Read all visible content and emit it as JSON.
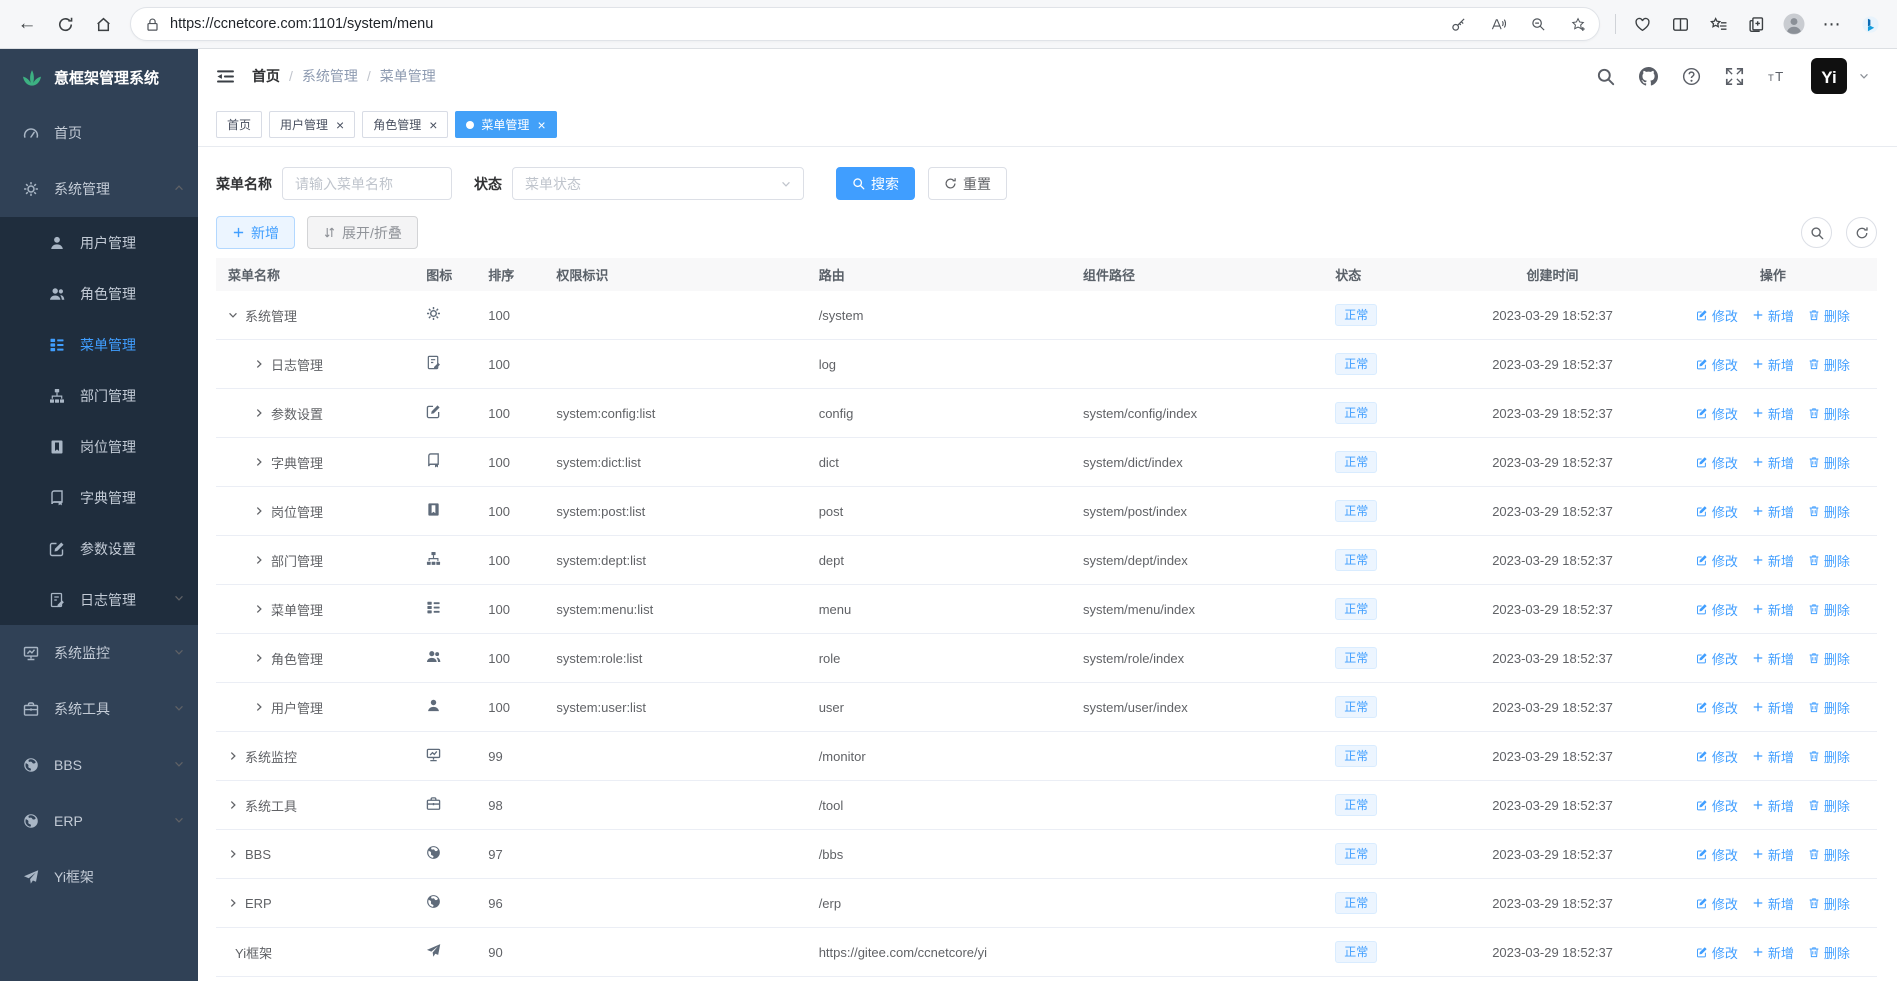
{
  "browser": {
    "url": "https://ccnetcore.com:1101/system/menu",
    "nav_icons": [
      "back-icon",
      "reload-icon",
      "home-icon"
    ],
    "pill_icons": [
      "lock-icon",
      "key-icon",
      "read-aloud-icon",
      "zoom-out-icon",
      "add-favorite-icon"
    ],
    "right_icons": [
      "browser-essentials-icon",
      "split-screen-icon",
      "favorites-icon",
      "collections-icon",
      "profile-avatar",
      "more-icon",
      "bing-chat-icon"
    ]
  },
  "sidebar": {
    "title": "意框架管理系统",
    "items": [
      {
        "label": "首页",
        "icon": "dashboard"
      },
      {
        "label": "系统管理",
        "icon": "gear",
        "expanded": true,
        "chevron": "up",
        "children": [
          {
            "label": "用户管理",
            "icon": "user"
          },
          {
            "label": "角色管理",
            "icon": "users"
          },
          {
            "label": "菜单管理",
            "icon": "tree-list",
            "active": true
          },
          {
            "label": "部门管理",
            "icon": "org"
          },
          {
            "label": "岗位管理",
            "icon": "badge"
          },
          {
            "label": "字典管理",
            "icon": "dict"
          },
          {
            "label": "参数设置",
            "icon": "edit-square"
          },
          {
            "label": "日志管理",
            "icon": "log",
            "chevron": "down"
          }
        ]
      },
      {
        "label": "系统监控",
        "icon": "monitor",
        "chevron": "down"
      },
      {
        "label": "系统工具",
        "icon": "toolbox",
        "chevron": "down"
      },
      {
        "label": "BBS",
        "icon": "globe",
        "chevron": "down"
      },
      {
        "label": "ERP",
        "icon": "globe",
        "chevron": "down"
      },
      {
        "label": "Yi框架",
        "icon": "send"
      }
    ]
  },
  "header": {
    "breadcrumb": [
      "首页",
      "系统管理",
      "菜单管理"
    ],
    "right_icons": [
      "search-icon",
      "github-icon",
      "question-icon",
      "fullscreen-icon",
      "font-size-icon"
    ]
  },
  "tabs": [
    {
      "label": "首页"
    },
    {
      "label": "用户管理",
      "closable": true
    },
    {
      "label": "角色管理",
      "closable": true
    },
    {
      "label": "菜单管理",
      "closable": true,
      "active": true
    }
  ],
  "filters": {
    "name_label": "菜单名称",
    "name_placeholder": "请输入菜单名称",
    "status_label": "状态",
    "status_placeholder": "菜单状态",
    "search_label": "搜索",
    "reset_label": "重置"
  },
  "toolbar": {
    "add_label": "新增",
    "expand_label": "展开/折叠"
  },
  "table": {
    "headers": [
      "菜单名称",
      "图标",
      "排序",
      "权限标识",
      "路由",
      "组件路径",
      "状态",
      "创建时间",
      "操作"
    ],
    "action_labels": {
      "edit": "修改",
      "add": "新增",
      "delete": "删除"
    },
    "rows": [
      {
        "name": "系统管理",
        "level": 0,
        "expand": "expanded",
        "icon": "gear",
        "sort": "100",
        "perms": "",
        "route": "/system",
        "component": "",
        "status": "正常",
        "created": "2023-03-29 18:52:37"
      },
      {
        "name": "日志管理",
        "level": 1,
        "expand": "collapsed",
        "icon": "log",
        "sort": "100",
        "perms": "",
        "route": "log",
        "component": "",
        "status": "正常",
        "created": "2023-03-29 18:52:37"
      },
      {
        "name": "参数设置",
        "level": 1,
        "expand": "collapsed",
        "icon": "edit-square",
        "sort": "100",
        "perms": "system:config:list",
        "route": "config",
        "component": "system/config/index",
        "status": "正常",
        "created": "2023-03-29 18:52:37"
      },
      {
        "name": "字典管理",
        "level": 1,
        "expand": "collapsed",
        "icon": "dict",
        "sort": "100",
        "perms": "system:dict:list",
        "route": "dict",
        "component": "system/dict/index",
        "status": "正常",
        "created": "2023-03-29 18:52:37"
      },
      {
        "name": "岗位管理",
        "level": 1,
        "expand": "collapsed",
        "icon": "badge",
        "sort": "100",
        "perms": "system:post:list",
        "route": "post",
        "component": "system/post/index",
        "status": "正常",
        "created": "2023-03-29 18:52:37"
      },
      {
        "name": "部门管理",
        "level": 1,
        "expand": "collapsed",
        "icon": "org",
        "sort": "100",
        "perms": "system:dept:list",
        "route": "dept",
        "component": "system/dept/index",
        "status": "正常",
        "created": "2023-03-29 18:52:37"
      },
      {
        "name": "菜单管理",
        "level": 1,
        "expand": "collapsed",
        "icon": "tree-list",
        "sort": "100",
        "perms": "system:menu:list",
        "route": "menu",
        "component": "system/menu/index",
        "status": "正常",
        "created": "2023-03-29 18:52:37"
      },
      {
        "name": "角色管理",
        "level": 1,
        "expand": "collapsed",
        "icon": "users",
        "sort": "100",
        "perms": "system:role:list",
        "route": "role",
        "component": "system/role/index",
        "status": "正常",
        "created": "2023-03-29 18:52:37"
      },
      {
        "name": "用户管理",
        "level": 1,
        "expand": "collapsed",
        "icon": "user",
        "sort": "100",
        "perms": "system:user:list",
        "route": "user",
        "component": "system/user/index",
        "status": "正常",
        "created": "2023-03-29 18:52:37"
      },
      {
        "name": "系统监控",
        "level": 0,
        "expand": "collapsed",
        "icon": "monitor",
        "sort": "99",
        "perms": "",
        "route": "/monitor",
        "component": "",
        "status": "正常",
        "created": "2023-03-29 18:52:37"
      },
      {
        "name": "系统工具",
        "level": 0,
        "expand": "collapsed",
        "icon": "toolbox",
        "sort": "98",
        "perms": "",
        "route": "/tool",
        "component": "",
        "status": "正常",
        "created": "2023-03-29 18:52:37"
      },
      {
        "name": "BBS",
        "level": 0,
        "expand": "collapsed",
        "icon": "globe",
        "sort": "97",
        "perms": "",
        "route": "/bbs",
        "component": "",
        "status": "正常",
        "created": "2023-03-29 18:52:37"
      },
      {
        "name": "ERP",
        "level": 0,
        "expand": "collapsed",
        "icon": "globe",
        "sort": "96",
        "perms": "",
        "route": "/erp",
        "component": "",
        "status": "正常",
        "created": "2023-03-29 18:52:37"
      },
      {
        "name": "Yi框架",
        "level": 0,
        "expand": "none",
        "icon": "send",
        "sort": "90",
        "perms": "",
        "route": "https://gitee.com/ccnetcore/yi",
        "component": "",
        "status": "正常",
        "created": "2023-03-29 18:52:37"
      }
    ]
  },
  "colors": {
    "accent": "#409eff",
    "sidebar_bg": "#304156",
    "submenu_bg": "#1f2d3d",
    "tab_active_bg": "#42a0f8",
    "status_tag_bg": "#ecf5ff",
    "status_tag_text": "#409eff"
  }
}
